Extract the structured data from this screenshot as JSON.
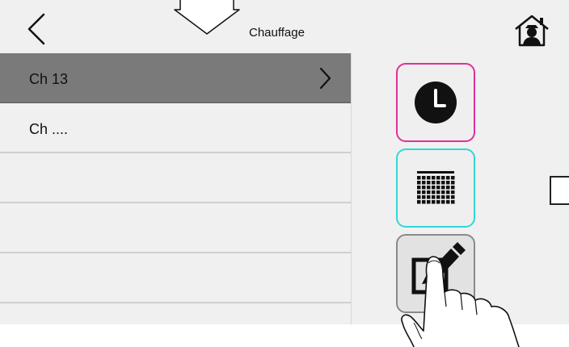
{
  "header": {
    "title": "Chauffage",
    "back_icon": "chevron-left-icon",
    "home_icon": "home-icon"
  },
  "list": {
    "items": [
      {
        "label": "Ch 13",
        "selected": true,
        "icon": "chevron-right-icon"
      },
      {
        "label": "Ch ....",
        "selected": false
      },
      {
        "label": "",
        "selected": false
      },
      {
        "label": "",
        "selected": false
      },
      {
        "label": "",
        "selected": false
      }
    ]
  },
  "mode_buttons": [
    {
      "icon": "clock-icon",
      "border_color": "#e0309a"
    },
    {
      "icon": "calendar-icon",
      "border_color": "#33d6d6"
    },
    {
      "icon": "edit-icon",
      "border_color": "#8a8a8a",
      "pressed": true
    }
  ],
  "annotations": {
    "down_arrow_icon": "down-arrow-icon",
    "hand_icon": "pointing-hand-icon"
  },
  "colors": {
    "background": "#f0f0f0",
    "selected_row": "#7a7a7a",
    "clock_border": "#e0309a",
    "calendar_border": "#33d6d6"
  }
}
